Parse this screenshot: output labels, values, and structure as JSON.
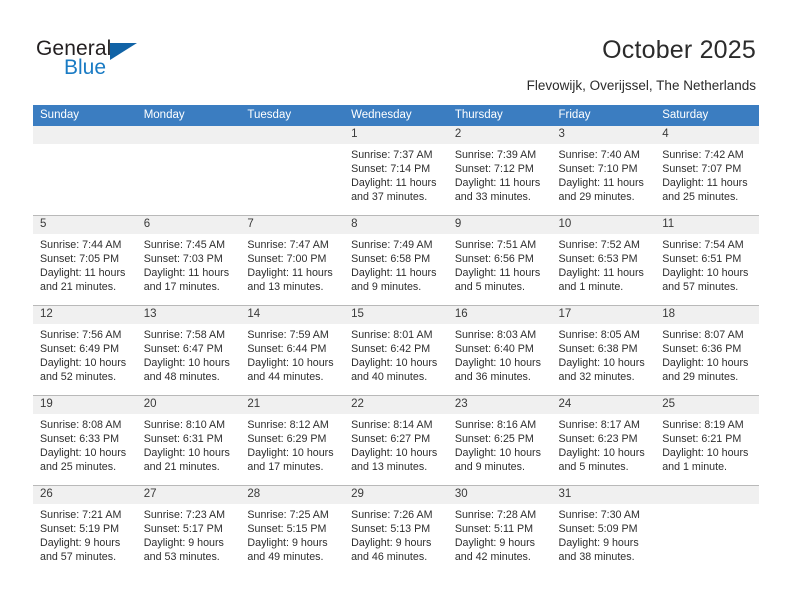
{
  "logo": {
    "word_top": "General",
    "word_bottom": "Blue",
    "triangle_color": "#1163a6",
    "blue_color": "#1a7bc4",
    "icon": "general-blue-logo"
  },
  "header": {
    "title": "October 2025",
    "subtitle": "Flevowijk, Overijssel, The Netherlands",
    "accent_color": "#3b7dc1"
  },
  "weekdays": [
    "Sunday",
    "Monday",
    "Tuesday",
    "Wednesday",
    "Thursday",
    "Friday",
    "Saturday"
  ],
  "labels": {
    "sunrise": "Sunrise:",
    "sunset": "Sunset:",
    "daylight": "Daylight:"
  },
  "weeks": [
    [
      {
        "day": "",
        "sunrise": "",
        "sunset": "",
        "daylight_l1": "",
        "daylight_l2": ""
      },
      {
        "day": "",
        "sunrise": "",
        "sunset": "",
        "daylight_l1": "",
        "daylight_l2": ""
      },
      {
        "day": "",
        "sunrise": "",
        "sunset": "",
        "daylight_l1": "",
        "daylight_l2": ""
      },
      {
        "day": "1",
        "sunrise": "Sunrise: 7:37 AM",
        "sunset": "Sunset: 7:14 PM",
        "daylight_l1": "Daylight: 11 hours",
        "daylight_l2": "and 37 minutes."
      },
      {
        "day": "2",
        "sunrise": "Sunrise: 7:39 AM",
        "sunset": "Sunset: 7:12 PM",
        "daylight_l1": "Daylight: 11 hours",
        "daylight_l2": "and 33 minutes."
      },
      {
        "day": "3",
        "sunrise": "Sunrise: 7:40 AM",
        "sunset": "Sunset: 7:10 PM",
        "daylight_l1": "Daylight: 11 hours",
        "daylight_l2": "and 29 minutes."
      },
      {
        "day": "4",
        "sunrise": "Sunrise: 7:42 AM",
        "sunset": "Sunset: 7:07 PM",
        "daylight_l1": "Daylight: 11 hours",
        "daylight_l2": "and 25 minutes."
      }
    ],
    [
      {
        "day": "5",
        "sunrise": "Sunrise: 7:44 AM",
        "sunset": "Sunset: 7:05 PM",
        "daylight_l1": "Daylight: 11 hours",
        "daylight_l2": "and 21 minutes."
      },
      {
        "day": "6",
        "sunrise": "Sunrise: 7:45 AM",
        "sunset": "Sunset: 7:03 PM",
        "daylight_l1": "Daylight: 11 hours",
        "daylight_l2": "and 17 minutes."
      },
      {
        "day": "7",
        "sunrise": "Sunrise: 7:47 AM",
        "sunset": "Sunset: 7:00 PM",
        "daylight_l1": "Daylight: 11 hours",
        "daylight_l2": "and 13 minutes."
      },
      {
        "day": "8",
        "sunrise": "Sunrise: 7:49 AM",
        "sunset": "Sunset: 6:58 PM",
        "daylight_l1": "Daylight: 11 hours",
        "daylight_l2": "and 9 minutes."
      },
      {
        "day": "9",
        "sunrise": "Sunrise: 7:51 AM",
        "sunset": "Sunset: 6:56 PM",
        "daylight_l1": "Daylight: 11 hours",
        "daylight_l2": "and 5 minutes."
      },
      {
        "day": "10",
        "sunrise": "Sunrise: 7:52 AM",
        "sunset": "Sunset: 6:53 PM",
        "daylight_l1": "Daylight: 11 hours",
        "daylight_l2": "and 1 minute."
      },
      {
        "day": "11",
        "sunrise": "Sunrise: 7:54 AM",
        "sunset": "Sunset: 6:51 PM",
        "daylight_l1": "Daylight: 10 hours",
        "daylight_l2": "and 57 minutes."
      }
    ],
    [
      {
        "day": "12",
        "sunrise": "Sunrise: 7:56 AM",
        "sunset": "Sunset: 6:49 PM",
        "daylight_l1": "Daylight: 10 hours",
        "daylight_l2": "and 52 minutes."
      },
      {
        "day": "13",
        "sunrise": "Sunrise: 7:58 AM",
        "sunset": "Sunset: 6:47 PM",
        "daylight_l1": "Daylight: 10 hours",
        "daylight_l2": "and 48 minutes."
      },
      {
        "day": "14",
        "sunrise": "Sunrise: 7:59 AM",
        "sunset": "Sunset: 6:44 PM",
        "daylight_l1": "Daylight: 10 hours",
        "daylight_l2": "and 44 minutes."
      },
      {
        "day": "15",
        "sunrise": "Sunrise: 8:01 AM",
        "sunset": "Sunset: 6:42 PM",
        "daylight_l1": "Daylight: 10 hours",
        "daylight_l2": "and 40 minutes."
      },
      {
        "day": "16",
        "sunrise": "Sunrise: 8:03 AM",
        "sunset": "Sunset: 6:40 PM",
        "daylight_l1": "Daylight: 10 hours",
        "daylight_l2": "and 36 minutes."
      },
      {
        "day": "17",
        "sunrise": "Sunrise: 8:05 AM",
        "sunset": "Sunset: 6:38 PM",
        "daylight_l1": "Daylight: 10 hours",
        "daylight_l2": "and 32 minutes."
      },
      {
        "day": "18",
        "sunrise": "Sunrise: 8:07 AM",
        "sunset": "Sunset: 6:36 PM",
        "daylight_l1": "Daylight: 10 hours",
        "daylight_l2": "and 29 minutes."
      }
    ],
    [
      {
        "day": "19",
        "sunrise": "Sunrise: 8:08 AM",
        "sunset": "Sunset: 6:33 PM",
        "daylight_l1": "Daylight: 10 hours",
        "daylight_l2": "and 25 minutes."
      },
      {
        "day": "20",
        "sunrise": "Sunrise: 8:10 AM",
        "sunset": "Sunset: 6:31 PM",
        "daylight_l1": "Daylight: 10 hours",
        "daylight_l2": "and 21 minutes."
      },
      {
        "day": "21",
        "sunrise": "Sunrise: 8:12 AM",
        "sunset": "Sunset: 6:29 PM",
        "daylight_l1": "Daylight: 10 hours",
        "daylight_l2": "and 17 minutes."
      },
      {
        "day": "22",
        "sunrise": "Sunrise: 8:14 AM",
        "sunset": "Sunset: 6:27 PM",
        "daylight_l1": "Daylight: 10 hours",
        "daylight_l2": "and 13 minutes."
      },
      {
        "day": "23",
        "sunrise": "Sunrise: 8:16 AM",
        "sunset": "Sunset: 6:25 PM",
        "daylight_l1": "Daylight: 10 hours",
        "daylight_l2": "and 9 minutes."
      },
      {
        "day": "24",
        "sunrise": "Sunrise: 8:17 AM",
        "sunset": "Sunset: 6:23 PM",
        "daylight_l1": "Daylight: 10 hours",
        "daylight_l2": "and 5 minutes."
      },
      {
        "day": "25",
        "sunrise": "Sunrise: 8:19 AM",
        "sunset": "Sunset: 6:21 PM",
        "daylight_l1": "Daylight: 10 hours",
        "daylight_l2": "and 1 minute."
      }
    ],
    [
      {
        "day": "26",
        "sunrise": "Sunrise: 7:21 AM",
        "sunset": "Sunset: 5:19 PM",
        "daylight_l1": "Daylight: 9 hours",
        "daylight_l2": "and 57 minutes."
      },
      {
        "day": "27",
        "sunrise": "Sunrise: 7:23 AM",
        "sunset": "Sunset: 5:17 PM",
        "daylight_l1": "Daylight: 9 hours",
        "daylight_l2": "and 53 minutes."
      },
      {
        "day": "28",
        "sunrise": "Sunrise: 7:25 AM",
        "sunset": "Sunset: 5:15 PM",
        "daylight_l1": "Daylight: 9 hours",
        "daylight_l2": "and 49 minutes."
      },
      {
        "day": "29",
        "sunrise": "Sunrise: 7:26 AM",
        "sunset": "Sunset: 5:13 PM",
        "daylight_l1": "Daylight: 9 hours",
        "daylight_l2": "and 46 minutes."
      },
      {
        "day": "30",
        "sunrise": "Sunrise: 7:28 AM",
        "sunset": "Sunset: 5:11 PM",
        "daylight_l1": "Daylight: 9 hours",
        "daylight_l2": "and 42 minutes."
      },
      {
        "day": "31",
        "sunrise": "Sunrise: 7:30 AM",
        "sunset": "Sunset: 5:09 PM",
        "daylight_l1": "Daylight: 9 hours",
        "daylight_l2": "and 38 minutes."
      },
      {
        "day": "",
        "sunrise": "",
        "sunset": "",
        "daylight_l1": "",
        "daylight_l2": ""
      }
    ]
  ]
}
